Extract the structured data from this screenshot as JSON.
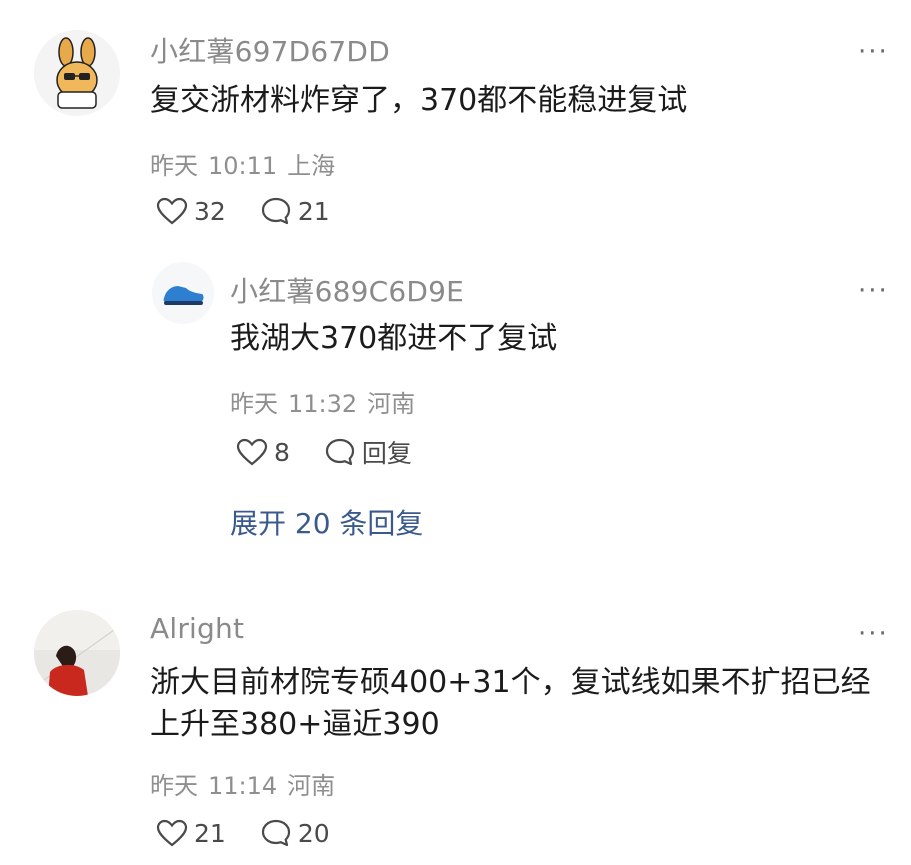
{
  "comments": [
    {
      "username": "小红薯697D67DD",
      "text": "复交浙材料炸穿了，370都不能稳进复试",
      "date": "昨天",
      "time": "10:11",
      "location": "上海",
      "likes": "32",
      "replies": "21",
      "avatar_icon": "cartoon-bunny-avatar",
      "reply": {
        "username": "小红薯689C6D9E",
        "text": "我湖大370都进不了复试",
        "date": "昨天",
        "time": "11:32",
        "location": "河南",
        "likes": "8",
        "reply_label": "回复",
        "avatar_icon": "blue-shoe-avatar"
      },
      "expand_label": "展开 20 条回复"
    },
    {
      "username": "Alright",
      "text_line1": "浙大目前材院专硕400+31个，复试线如果不扩招已经",
      "text_line2": "上升至380+逼近390",
      "date": "昨天",
      "time": "11:14",
      "location": "河南",
      "likes": "21",
      "replies": "20",
      "avatar_icon": "photo-avatar"
    }
  ],
  "more_label": "···"
}
